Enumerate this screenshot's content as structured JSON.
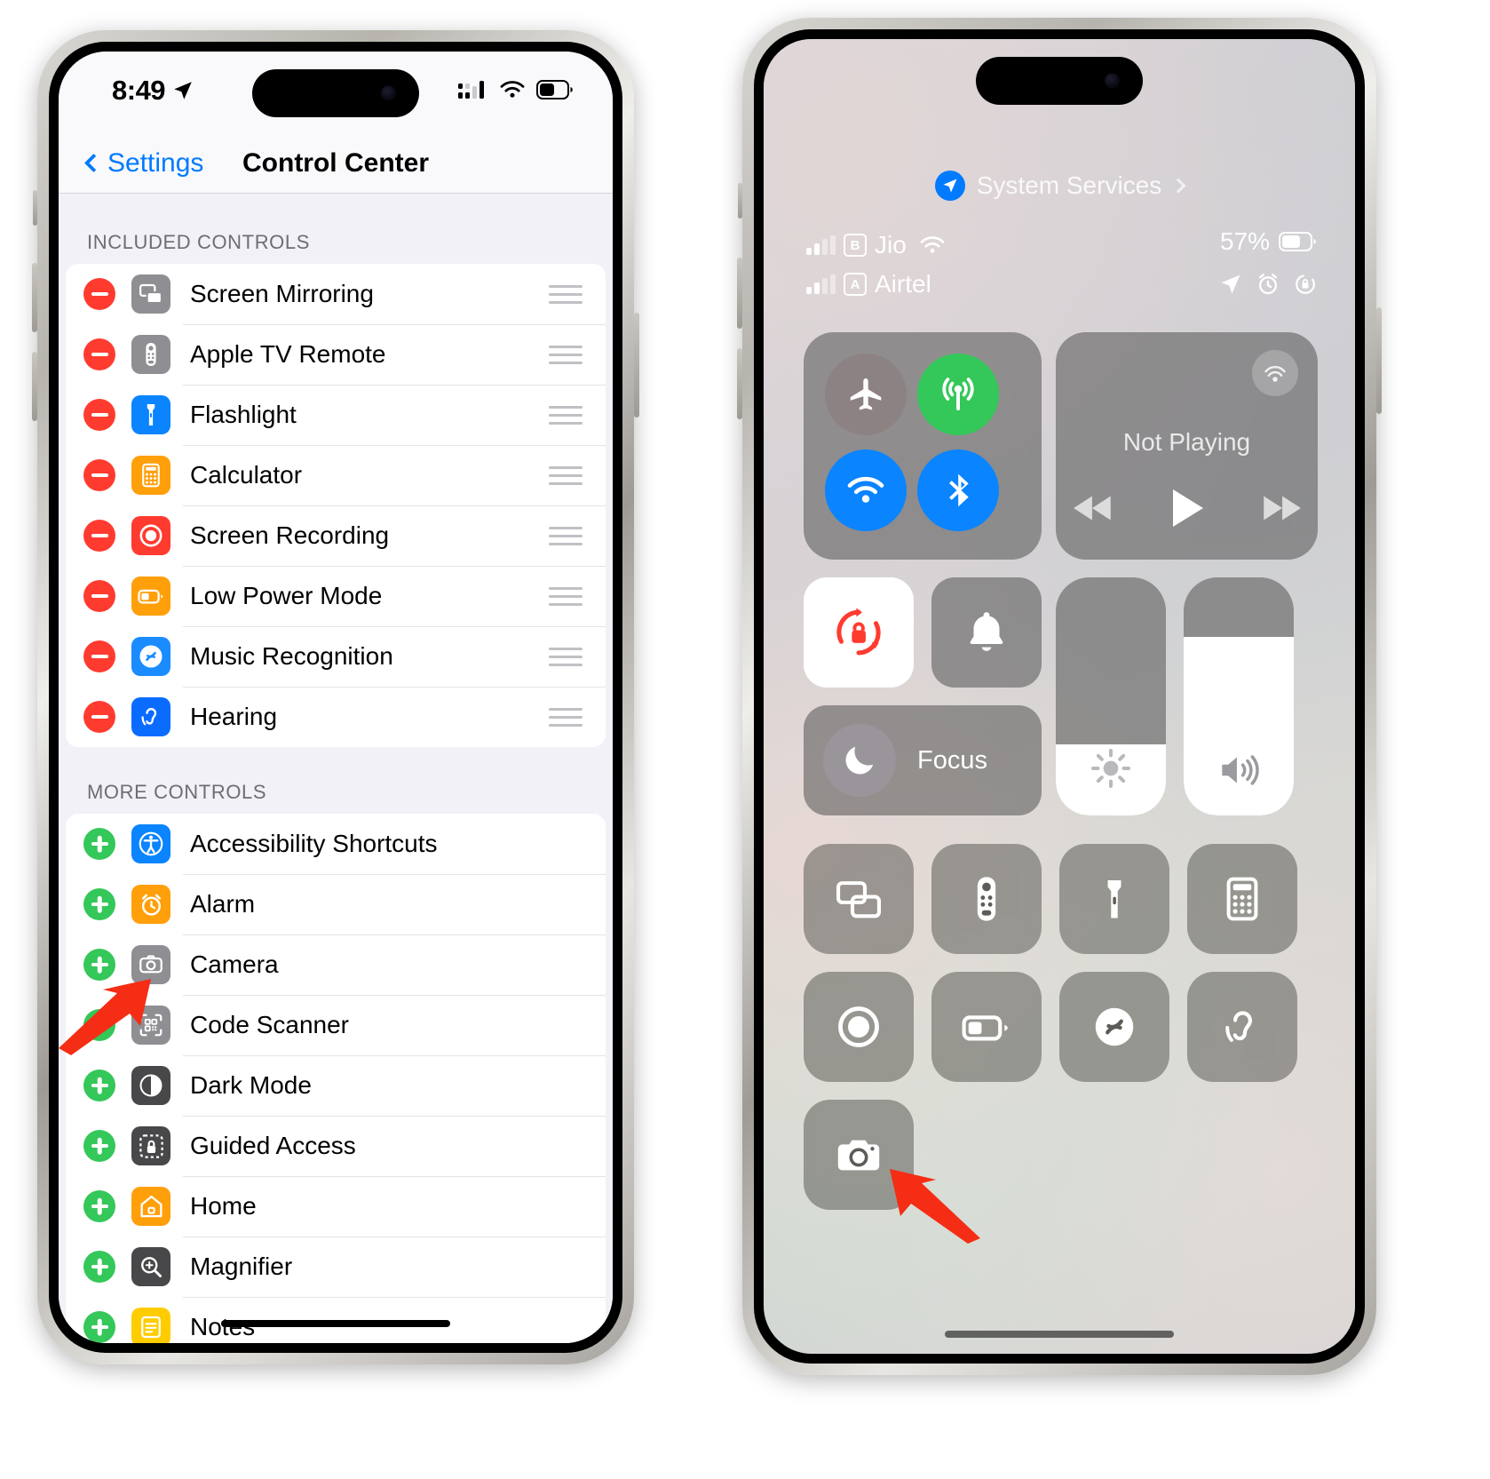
{
  "left_phone": {
    "status_bar": {
      "time": "8:49",
      "location_icon": "location-arrow-icon",
      "cellular_icon": "cellular-bars-icon",
      "wifi_icon": "wifi-icon",
      "battery_icon": "battery-icon"
    },
    "nav": {
      "back_label": "Settings",
      "title": "Control Center",
      "back_icon": "chevron-left-icon"
    },
    "sections": [
      {
        "header": "INCLUDED CONTROLS",
        "action": "remove",
        "items": [
          {
            "label": "Screen Mirroring",
            "icon": "screen-mirroring-icon",
            "color": "#8e8e93"
          },
          {
            "label": "Apple TV Remote",
            "icon": "apple-tv-remote-icon",
            "color": "#8e8e93"
          },
          {
            "label": "Flashlight",
            "icon": "flashlight-icon",
            "color": "#0a84ff"
          },
          {
            "label": "Calculator",
            "icon": "calculator-icon",
            "color": "#ff9f0a"
          },
          {
            "label": "Screen Recording",
            "icon": "screen-recording-icon",
            "color": "#ff3b30"
          },
          {
            "label": "Low Power Mode",
            "icon": "low-power-mode-icon",
            "color": "#ff9f0a"
          },
          {
            "label": "Music Recognition",
            "icon": "shazam-icon",
            "color": "#1a8cff"
          },
          {
            "label": "Hearing",
            "icon": "hearing-icon",
            "color": "#0a6cff"
          }
        ]
      },
      {
        "header": "MORE CONTROLS",
        "action": "add",
        "items": [
          {
            "label": "Accessibility Shortcuts",
            "icon": "accessibility-icon",
            "color": "#0a84ff"
          },
          {
            "label": "Alarm",
            "icon": "alarm-clock-icon",
            "color": "#ff9f0a"
          },
          {
            "label": "Camera",
            "icon": "camera-icon",
            "color": "#8e8e93"
          },
          {
            "label": "Code Scanner",
            "icon": "qr-code-scanner-icon",
            "color": "#8e8e93"
          },
          {
            "label": "Dark Mode",
            "icon": "dark-mode-icon",
            "color": "#48484a"
          },
          {
            "label": "Guided Access",
            "icon": "guided-access-lock-icon",
            "color": "#48484a"
          },
          {
            "label": "Home",
            "icon": "home-house-icon",
            "color": "#ff9f0a"
          },
          {
            "label": "Magnifier",
            "icon": "magnifier-icon",
            "color": "#48484a"
          },
          {
            "label": "Notes",
            "icon": "notes-icon",
            "color": "#ffcc00"
          }
        ]
      }
    ]
  },
  "right_phone": {
    "system_services": {
      "label": "System Services",
      "icon": "location-arrow-icon",
      "chevron": "chevron-right-icon"
    },
    "status": {
      "carriers": [
        {
          "sim": "B",
          "name": "Jio",
          "signal_bars": 2,
          "wifi": true
        },
        {
          "sim": "A",
          "name": "Airtel",
          "signal_bars": 2,
          "wifi": false
        }
      ],
      "battery_percent": "57%",
      "icons": [
        "location-arrow-icon",
        "alarm-clock-icon",
        "rotation-lock-icon"
      ]
    },
    "connectivity": [
      {
        "name": "airplane-mode-icon",
        "label": "Airplane Mode",
        "state": "off",
        "color": "#8c7d7d"
      },
      {
        "name": "cellular-data-icon",
        "label": "Cellular Data",
        "state": "on",
        "color": "#34c759"
      },
      {
        "name": "wifi-icon",
        "label": "Wi-Fi",
        "state": "on",
        "color": "#0a84ff"
      },
      {
        "name": "bluetooth-icon",
        "label": "Bluetooth",
        "state": "on",
        "color": "#0a84ff"
      }
    ],
    "media": {
      "title": "Not Playing",
      "airplay_icon": "airplay-audio-icon",
      "controls": [
        "rewind-icon",
        "play-icon",
        "fast-forward-icon"
      ]
    },
    "toggles": [
      {
        "name": "rotation-lock-icon",
        "label": "Rotation Lock",
        "state": "on"
      },
      {
        "name": "silent-mode-bell-icon",
        "label": "Ring / Silent",
        "state": "off"
      }
    ],
    "focus": {
      "label": "Focus",
      "icon": "moon-icon"
    },
    "sliders": [
      {
        "name": "brightness-slider",
        "icon": "brightness-sun-icon",
        "value": 30
      },
      {
        "name": "volume-slider",
        "icon": "volume-speaker-icon",
        "value": 75
      }
    ],
    "control_tiles": [
      {
        "name": "screen-mirroring-icon",
        "label": "Screen Mirroring"
      },
      {
        "name": "apple-tv-remote-icon",
        "label": "Apple TV Remote"
      },
      {
        "name": "flashlight-icon",
        "label": "Flashlight"
      },
      {
        "name": "calculator-icon",
        "label": "Calculator"
      },
      {
        "name": "screen-recording-icon",
        "label": "Screen Recording"
      },
      {
        "name": "low-power-mode-icon",
        "label": "Low Power Mode"
      },
      {
        "name": "shazam-icon",
        "label": "Music Recognition"
      },
      {
        "name": "hearing-icon",
        "label": "Hearing"
      },
      {
        "name": "camera-icon",
        "label": "Camera"
      }
    ]
  },
  "annotations": [
    {
      "name": "arrow-pointing-to-camera-row",
      "color": "#ff2d16"
    },
    {
      "name": "arrow-pointing-to-camera-tile",
      "color": "#ff2d16"
    }
  ]
}
